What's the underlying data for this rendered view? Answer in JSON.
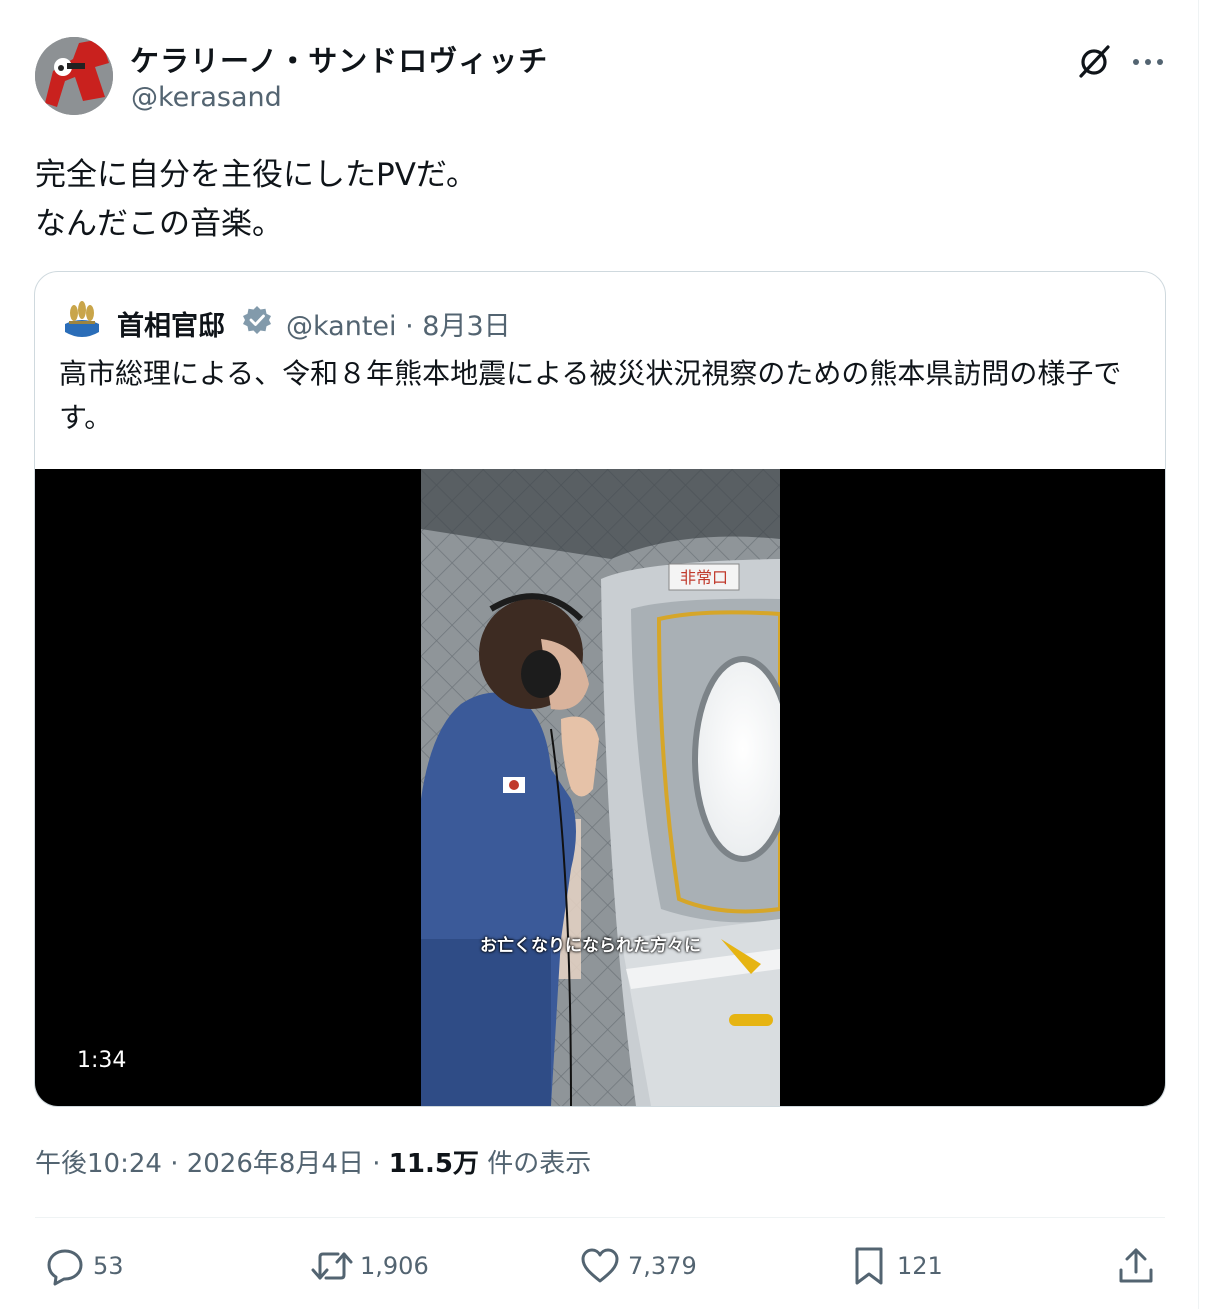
{
  "author": {
    "display_name": "ケラリーノ・サンドロヴィッチ",
    "handle": "@kerasand",
    "avatar_icon": "avatar-image"
  },
  "header_buttons": {
    "grok_icon": "grok-icon",
    "more_icon": "more-icon"
  },
  "tweet": {
    "lines": [
      "完全に自分を主役にしたPVだ。",
      "なんだこの音楽。"
    ]
  },
  "quote": {
    "display_name": "首相官邸",
    "verified_icon": "verified-badge-icon",
    "handle_date": "@kantei · 8月3日",
    "text": "高市総理による、令和８年熊本地震による被災状況視察のための熊本県訪問の様子です。",
    "video": {
      "caption": "お亡くなりになられた方々に",
      "duration": "1:34",
      "sign_text": "非常口"
    }
  },
  "meta": {
    "time_date": "午後10:24 · 2026年8月4日 · ",
    "views": "11.5万",
    "views_label": " 件の表示"
  },
  "actions": {
    "replies": "53",
    "retweets": "1,906",
    "likes": "7,379",
    "bookmarks": "121"
  },
  "colors": {
    "text": "#0f1419",
    "secondary": "#536471",
    "border": "#cfd9de",
    "verified": "#829aab"
  }
}
